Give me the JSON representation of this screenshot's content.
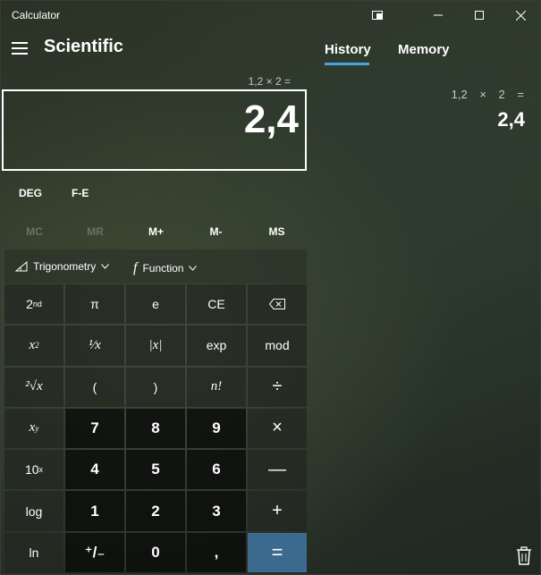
{
  "window": {
    "title": "Calculator"
  },
  "header": {
    "mode_title": "Scientific"
  },
  "panel": {
    "tabs": [
      {
        "label": "History"
      },
      {
        "label": "Memory"
      }
    ],
    "history": {
      "expression": "1,2 × 2 =",
      "result": "2,4"
    }
  },
  "display": {
    "expression": "1,2 × 2 =",
    "value": "2,4"
  },
  "mode": {
    "angle": "DEG",
    "fe": "F-E"
  },
  "memory": {
    "mc": "MC",
    "mr": "MR",
    "mplus": "M+",
    "mminus": "M-",
    "ms": "MS"
  },
  "functions": {
    "trig": "Trigonometry",
    "func": "Function"
  },
  "keys": {
    "second": "2",
    "second_sup": "nd",
    "pi": "π",
    "e": "e",
    "ce": "CE",
    "x_squared_base": "x",
    "x_squared_sup": "2",
    "reciprocal": "¹⁄x",
    "abs": "|x|",
    "exp": "exp",
    "mod": "mod",
    "sqrt": "²√x",
    "paren_open": "(",
    "paren_close": ")",
    "factorial": "n!",
    "divide": "÷",
    "x_pow_base": "x",
    "x_pow_sup": "y",
    "n7": "7",
    "n8": "8",
    "n9": "9",
    "multiply": "×",
    "ten_pow_base": "10",
    "ten_pow_sup": "x",
    "n4": "4",
    "n5": "5",
    "n6": "6",
    "minus": "—",
    "log": "log",
    "n1": "1",
    "n2": "2",
    "n3": "3",
    "plus": "+",
    "ln": "ln",
    "negate": "⁺/₋",
    "n0": "0",
    "decimal": ",",
    "equals": "="
  },
  "icons": {
    "hamburger": "hamburger-icon",
    "backspace": "backspace-icon",
    "trash": "trash-icon",
    "trig": "triangle-icon",
    "function": "function-icon",
    "accent_color": "#4aa0e6",
    "equals_color": "#3c6a8e"
  }
}
